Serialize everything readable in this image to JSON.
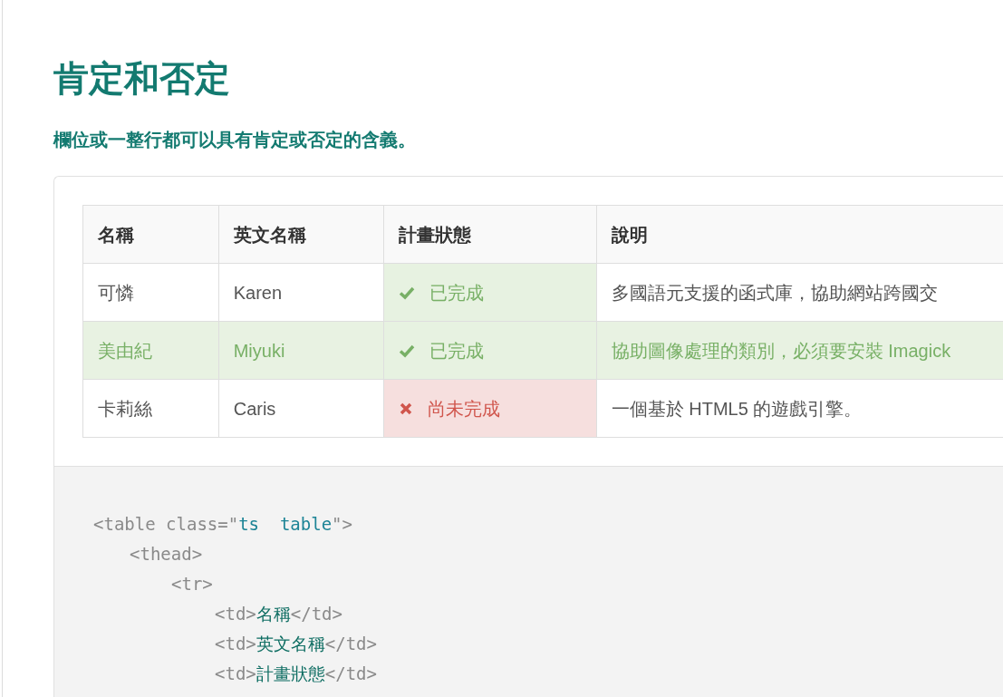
{
  "heading": "肯定和否定",
  "description": "欄位或一整行都可以具有肯定或否定的含義。",
  "table": {
    "columns": [
      "名稱",
      "英文名稱",
      "計畫狀態",
      "說明"
    ],
    "rows": [
      {
        "positive": false,
        "cells": [
          {
            "text": "可憐",
            "positive": false,
            "negative": false
          },
          {
            "text": "Karen",
            "positive": false,
            "negative": false
          },
          {
            "text": "已完成",
            "positive": true,
            "negative": false
          },
          {
            "text": "多國語元支援的函式庫，協助網站跨國交",
            "positive": false,
            "negative": false
          }
        ]
      },
      {
        "positive": true,
        "cells": [
          {
            "text": "美由紀",
            "positive": false,
            "negative": false
          },
          {
            "text": "Miyuki",
            "positive": false,
            "negative": false
          },
          {
            "text": "已完成",
            "positive": true,
            "negative": false
          },
          {
            "text": "協助圖像處理的類別，必須要安裝 Imagick",
            "positive": false,
            "negative": false
          }
        ]
      },
      {
        "positive": false,
        "cells": [
          {
            "text": "卡莉絲",
            "positive": false,
            "negative": false
          },
          {
            "text": "Caris",
            "positive": false,
            "negative": false
          },
          {
            "text": "尚未完成",
            "positive": false,
            "negative": true
          },
          {
            "text": "一個基於 HTML5 的遊戲引擎。",
            "positive": false,
            "negative": false
          }
        ]
      }
    ]
  },
  "code": [
    {
      "segments": [
        {
          "kind": "tag",
          "text": "<table class=\""
        },
        {
          "kind": "string",
          "text": "ts  table"
        },
        {
          "kind": "tag",
          "text": "\">"
        }
      ],
      "children": [
        {
          "segments": [
            {
              "kind": "tag",
              "text": "<thead>"
            }
          ],
          "children": [
            {
              "segments": [
                {
                  "kind": "tag",
                  "text": "<tr>"
                }
              ],
              "children": [
                {
                  "segments": [
                    {
                      "kind": "tag",
                      "text": "<td>"
                    },
                    {
                      "kind": "text",
                      "text": "名稱"
                    },
                    {
                      "kind": "tag",
                      "text": "</td>"
                    }
                  ]
                },
                {
                  "segments": [
                    {
                      "kind": "tag",
                      "text": "<td>"
                    },
                    {
                      "kind": "text",
                      "text": "英文名稱"
                    },
                    {
                      "kind": "tag",
                      "text": "</td>"
                    }
                  ]
                },
                {
                  "segments": [
                    {
                      "kind": "tag",
                      "text": "<td>"
                    },
                    {
                      "kind": "text",
                      "text": "計畫狀態"
                    },
                    {
                      "kind": "tag",
                      "text": "</td>"
                    }
                  ]
                }
              ]
            }
          ]
        }
      ]
    }
  ]
}
